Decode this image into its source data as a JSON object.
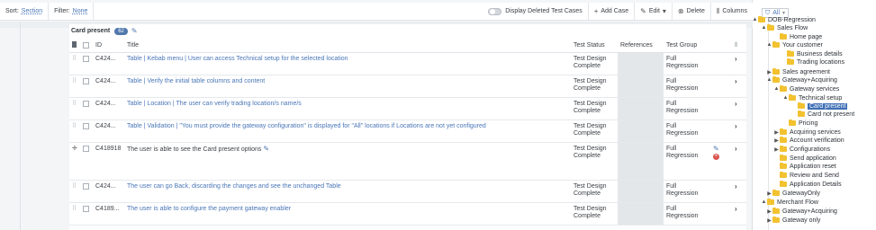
{
  "toolbar": {
    "sort_label": "Sort:",
    "sort_value": "Section",
    "filter_label": "Filter:",
    "filter_value": "None",
    "display_deleted_label": "Display Deleted Test Cases",
    "add_case_label": "Add Case",
    "edit_label": "Edit",
    "delete_label": "Delete",
    "columns_label": "Columns"
  },
  "section": {
    "title": "Card present",
    "count": "62"
  },
  "table": {
    "headers": {
      "id": "ID",
      "title": "Title",
      "status": "Test Status",
      "references": "References",
      "group": "Test Group"
    },
    "rows": [
      {
        "id": "C424...",
        "title": "Table | Kebab menu | User can access Technical setup for the selected location",
        "status": "Test Design Complete",
        "group": "Full Regression"
      },
      {
        "id": "C424...",
        "title": "Table | Verify the initial table columns and content",
        "status": "Test Design Complete",
        "group": "Full Regression"
      },
      {
        "id": "C424...",
        "title": "Table | Location | The user can verify trading location/s name/s",
        "status": "Test Design Complete",
        "group": "Full Regression"
      },
      {
        "id": "C424...",
        "title": "Table | Validation | \"You must provide the gateway configuration\" is displayed for \"All\" locations if Locations are not yet configured",
        "status": "Test Design Complete",
        "group": "Full Regression"
      },
      {
        "id": "C418918",
        "title": "The user is able to see the Card present options",
        "status": "Test Design Complete",
        "group": "Full Regression"
      },
      {
        "id": "C424...",
        "title": "The user can go Back, discarding the changes and see the unchanged Table",
        "status": "Test Design Complete",
        "group": "Full Regression"
      },
      {
        "id": "C4189...",
        "title": "The user is able to configure the payment gateway enabler",
        "status": "Test Design Complete",
        "group": "Full Regression"
      }
    ]
  },
  "tree": {
    "filter_value": "All",
    "nodes": [
      {
        "label": "DOB-Regression",
        "expander": "▲"
      },
      {
        "label": "Sales Flow",
        "expander": "▲"
      },
      {
        "label": "Home page",
        "expander": ""
      },
      {
        "label": "Your customer",
        "expander": "▲"
      },
      {
        "label": "Business details",
        "expander": ""
      },
      {
        "label": "Trading locations",
        "expander": ""
      },
      {
        "label": "Sales agreement",
        "expander": "▶"
      },
      {
        "label": "Gateway+Acquiring",
        "expander": "▲"
      },
      {
        "label": "Gateway services",
        "expander": "▲"
      },
      {
        "label": "Technical setup",
        "expander": "▲"
      },
      {
        "label": "Card present",
        "expander": ""
      },
      {
        "label": "Card not present",
        "expander": ""
      },
      {
        "label": "Pricing",
        "expander": ""
      },
      {
        "label": "Acquiring services",
        "expander": "▶"
      },
      {
        "label": "Account verification",
        "expander": "▶"
      },
      {
        "label": "Configurations",
        "expander": "▶"
      },
      {
        "label": "Send application",
        "expander": ""
      },
      {
        "label": "Application reset",
        "expander": ""
      },
      {
        "label": "Review and Send",
        "expander": ""
      },
      {
        "label": "Application Details",
        "expander": ""
      },
      {
        "label": "GatewayOnly",
        "expander": "▶"
      },
      {
        "label": "Merchant Flow",
        "expander": "▲"
      },
      {
        "label": "Gateway+Acquiring",
        "expander": "▶"
      },
      {
        "label": "Gateway only",
        "expander": "▶"
      }
    ]
  },
  "icons": {
    "toggle": "toggle-icon",
    "add": "plus-icon",
    "edit": "pencil-icon",
    "delete": "delete-circle-icon",
    "columns": "columns-icon",
    "folder": "folder-icon",
    "filter": "funnel-icon"
  },
  "colors": {
    "accent": "#4f77ad",
    "link": "#4a76b8",
    "folder": "#f2c230",
    "selected": "#3f6fb5",
    "delete": "#d9534f"
  }
}
